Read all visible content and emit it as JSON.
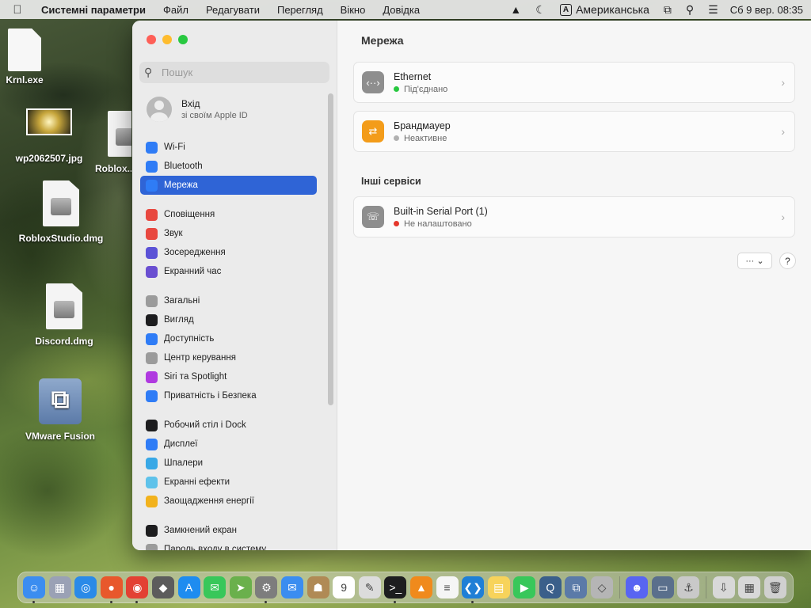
{
  "menubar": {
    "app_name": "Системні параметри",
    "items": [
      "Файл",
      "Редагувати",
      "Перегляд",
      "Вікно",
      "Довідка"
    ],
    "input_source_badge": "A",
    "input_source": "Американська",
    "clock": "Сб 9 вер.  08:35"
  },
  "desktop": {
    "icons": [
      {
        "label": "Krnl.exe",
        "icon": "document-icon"
      },
      {
        "label": "wp2062507.jpg",
        "icon": "image-thumbnail"
      },
      {
        "label": "Roblox...",
        "icon": "disk-image-icon"
      },
      {
        "label": "RobloxStudio.dmg",
        "icon": "disk-image-icon"
      },
      {
        "label": "Discord.dmg",
        "icon": "disk-image-icon"
      },
      {
        "label": "VMware Fusion",
        "icon": "vmware-icon"
      }
    ]
  },
  "sidebar": {
    "search_placeholder": "Пошук",
    "account": {
      "title": "Вхід",
      "subtitle": "зі своїм Apple ID"
    },
    "groups": [
      [
        {
          "label": "Wi-Fi",
          "icon": "wifi-icon",
          "color": "#2f7cf6"
        },
        {
          "label": "Bluetooth",
          "icon": "bluetooth-icon",
          "color": "#2f7cf6"
        },
        {
          "label": "Мережа",
          "icon": "globe-icon",
          "color": "#2f7cf6",
          "active": true
        }
      ],
      [
        {
          "label": "Сповіщення",
          "icon": "bell-icon",
          "color": "#e8483f"
        },
        {
          "label": "Звук",
          "icon": "speaker-icon",
          "color": "#e8483f"
        },
        {
          "label": "Зосередження",
          "icon": "moon-icon",
          "color": "#5b52d6"
        },
        {
          "label": "Екранний час",
          "icon": "hourglass-icon",
          "color": "#6a4fd1"
        }
      ],
      [
        {
          "label": "Загальні",
          "icon": "gear-icon",
          "color": "#9b9b9b"
        },
        {
          "label": "Вигляд",
          "icon": "appearance-icon",
          "color": "#1d1d1f"
        },
        {
          "label": "Доступність",
          "icon": "accessibility-icon",
          "color": "#2f7cf6"
        },
        {
          "label": "Центр керування",
          "icon": "control-center-icon",
          "color": "#9b9b9b"
        },
        {
          "label": "Siri та Spotlight",
          "icon": "siri-icon",
          "color": "#b03ae0"
        },
        {
          "label": "Приватність і Безпека",
          "icon": "hand-icon",
          "color": "#2f7cf6"
        }
      ],
      [
        {
          "label": "Робочий стіл і Dock",
          "icon": "dock-icon",
          "color": "#1d1d1f"
        },
        {
          "label": "Дисплеї",
          "icon": "display-icon",
          "color": "#2f7cf6"
        },
        {
          "label": "Шпалери",
          "icon": "wallpaper-icon",
          "color": "#38a8e6"
        },
        {
          "label": "Екранні ефекти",
          "icon": "screensaver-icon",
          "color": "#5ec2ea"
        },
        {
          "label": "Заощадження енергії",
          "icon": "bulb-icon",
          "color": "#f2b21c"
        }
      ],
      [
        {
          "label": "Замкнений екран",
          "icon": "lock-icon",
          "color": "#1d1d1f"
        },
        {
          "label": "Пароль входу в систему",
          "icon": "key-icon",
          "color": "#9b9b9b"
        }
      ]
    ]
  },
  "main": {
    "title": "Мережа",
    "services": [
      {
        "name": "Ethernet",
        "status": "Під'єднано",
        "status_color": "#28c840",
        "icon": "ethernet-icon",
        "icon_color": "#8e8e8e"
      },
      {
        "name": "Брандмауер",
        "status": "Неактивне",
        "status_color": "#b0b0b0",
        "icon": "firewall-icon",
        "icon_color": "#f39c1a"
      }
    ],
    "other_title": "Інші сервіси",
    "other_services": [
      {
        "name": "Built-in Serial Port (1)",
        "status": "Не налаштовано",
        "status_color": "#e5372c",
        "icon": "phone-icon",
        "icon_color": "#8e8e8e"
      }
    ],
    "more_button": "··· ⌄",
    "help_button": "?"
  },
  "dock": {
    "apps": [
      {
        "name": "finder-icon",
        "glyph": "☺",
        "color": "#3b8df0",
        "running": true
      },
      {
        "name": "launchpad-icon",
        "glyph": "▦",
        "color": "#9aa1b5"
      },
      {
        "name": "safari-icon",
        "glyph": "◎",
        "color": "#2a8ae8"
      },
      {
        "name": "firefox-icon",
        "glyph": "●",
        "color": "#e8582c",
        "running": true
      },
      {
        "name": "chrome-icon",
        "glyph": "◉",
        "color": "#e34133",
        "running": true
      },
      {
        "name": "roblox-icon",
        "glyph": "◆",
        "color": "#5c5c5c"
      },
      {
        "name": "app-store-icon",
        "glyph": "A",
        "color": "#1e8cf0"
      },
      {
        "name": "messages-icon",
        "glyph": "✉",
        "color": "#38c75a"
      },
      {
        "name": "maps-icon",
        "glyph": "➤",
        "color": "#6ab04c"
      },
      {
        "name": "system-settings-icon",
        "glyph": "⚙",
        "color": "#7d7d7d",
        "running": true
      },
      {
        "name": "mail-icon",
        "glyph": "✉",
        "color": "#3b8df0"
      },
      {
        "name": "contacts-icon",
        "glyph": "☗",
        "color": "#b08a55"
      },
      {
        "name": "calendar-icon",
        "glyph": "9",
        "color": "#ffffff"
      },
      {
        "name": "textedit-icon",
        "glyph": "✎",
        "color": "#dcdcdc"
      },
      {
        "name": "terminal-icon",
        "glyph": ">_",
        "color": "#1d1d1f",
        "running": true
      },
      {
        "name": "vlc-icon",
        "glyph": "▲",
        "color": "#f08a1c"
      },
      {
        "name": "reminders-icon",
        "glyph": "≡",
        "color": "#f5f5f5"
      },
      {
        "name": "vscode-icon",
        "glyph": "❮❯",
        "color": "#1f7fd6",
        "running": true
      },
      {
        "name": "notes-icon",
        "glyph": "▤",
        "color": "#f7d35b"
      },
      {
        "name": "facetime-icon",
        "glyph": "▶",
        "color": "#38c75a"
      },
      {
        "name": "quicktime-icon",
        "glyph": "Q",
        "color": "#3a5f8a"
      },
      {
        "name": "vmware-icon",
        "glyph": "⧉",
        "color": "#5b7aa8"
      },
      {
        "name": "disk-utility-icon",
        "glyph": "◇",
        "color": "#b5b5b5"
      },
      {
        "name": "discord-icon",
        "glyph": "☻",
        "color": "#5865f2",
        "separator_before": true
      },
      {
        "name": "screenshot-icon",
        "glyph": "▭",
        "color": "#5a6f8c"
      },
      {
        "name": "preview-icon",
        "glyph": "⚓",
        "color": "#c9c9c9"
      },
      {
        "name": "downloads-icon",
        "glyph": "⇩",
        "color": "#d8d8d8",
        "separator_before": true
      },
      {
        "name": "documents-icon",
        "glyph": "▦",
        "color": "#d8d8d8"
      },
      {
        "name": "trash-icon",
        "glyph": "🗑",
        "color": "#d0d0d0"
      }
    ]
  }
}
